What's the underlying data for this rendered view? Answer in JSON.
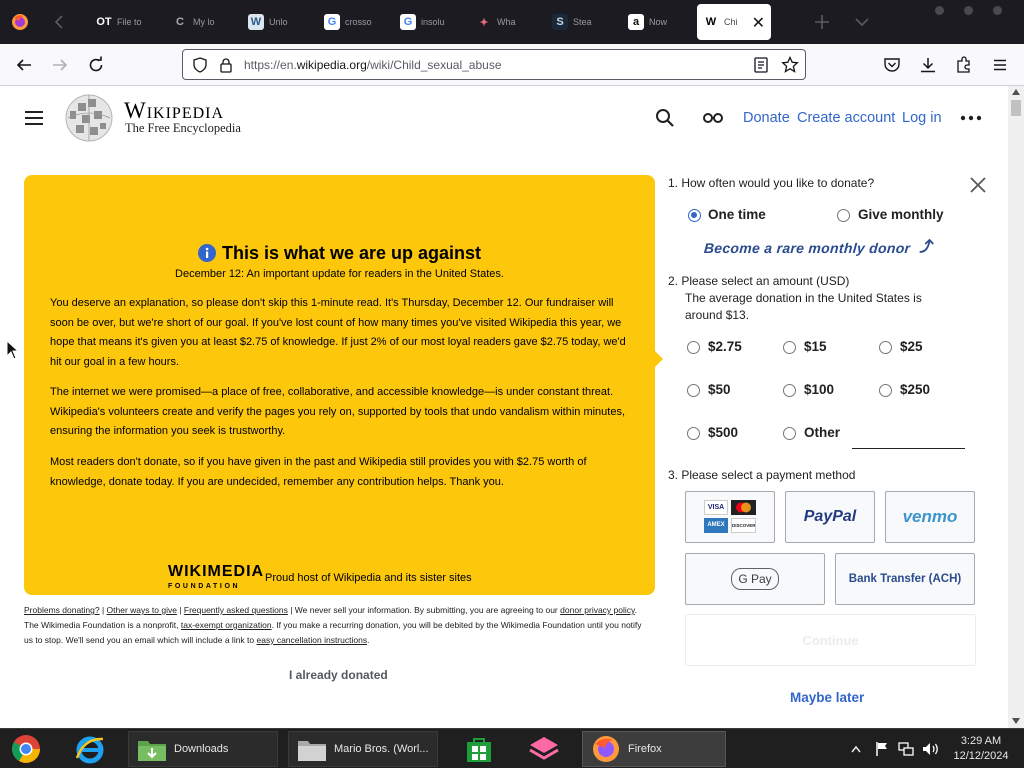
{
  "browser": {
    "tabs": [
      {
        "favicon": "OT",
        "title": "File to",
        "fav_bg": "#1c1b22",
        "fav_color": "#ffffff"
      },
      {
        "favicon": "C",
        "title": "My lo",
        "fav_bg": "#1c1b22",
        "fav_color": "#aaaaaa"
      },
      {
        "favicon": "W",
        "title": "Unlo",
        "fav_bg": "#dce6ee",
        "fav_color": "#2a5d8c"
      },
      {
        "favicon": "G",
        "title": "crosso",
        "fav_bg": "#ffffff",
        "fav_color": "#4285f4"
      },
      {
        "favicon": "G",
        "title": "insolu",
        "fav_bg": "#ffffff",
        "fav_color": "#4285f4"
      },
      {
        "favicon": "✦",
        "title": "Wha",
        "fav_bg": "#1c1b22",
        "fav_color": "#e26b7a"
      },
      {
        "favicon": "S",
        "title": "Stea",
        "fav_bg": "#1b2838",
        "fav_color": "#c7d5e0"
      },
      {
        "favicon": "a",
        "title": "Now",
        "fav_bg": "#ffffff",
        "fav_color": "#111111"
      },
      {
        "favicon": "W",
        "title": "Chi",
        "fav_bg": "#ffffff",
        "fav_color": "#000000"
      }
    ],
    "url_prefix": "https://en.",
    "url_domain": "wikipedia.org",
    "url_path": "/wiki/Child_sexual_abuse"
  },
  "wikipedia": {
    "title": "Wikipedia",
    "tagline": "The Free Encyclopedia",
    "donate": "Donate",
    "create_account": "Create account",
    "login": "Log in"
  },
  "banner": {
    "heading": "This is what we are up against",
    "subheading": "December 12: An important update for readers in the United States.",
    "paragraphs": [
      "You deserve an explanation, so please don't skip this 1-minute read. It's Thursday, December 12. Our fundraiser will soon be over, but we're short of our goal. If you've lost count of how many times you've visited Wikipedia this year, we hope that means it's given you at least $2.75 of knowledge. If just 2% of our most loyal readers gave $2.75 today, we'd hit our goal in a few hours.",
      "The internet we were promised—a place of free, collaborative, and accessible knowledge—is under constant threat. Wikipedia's volunteers create and verify the pages you rely on, supported by tools that undo vandalism within minutes, ensuring the information you seek is trustworthy.",
      "Most readers don't donate, so if you have given in the past and Wikipedia still provides you with $2.75 worth of knowledge, donate today. If you are undecided, remember any contribution helps. Thank you."
    ],
    "logo_main": "WIKIMEDIA",
    "logo_sub": "FOUNDATION",
    "host_line": "Proud host of Wikipedia and its sister sites",
    "accent": "#fdc70c"
  },
  "fineprint": {
    "problems": "Problems donating?",
    "other_ways": "Other ways to give",
    "faq": "Frequently asked questions",
    "text1": "We never sell your information. By submitting, you are agreeing to our",
    "donor_privacy": "donor privacy policy",
    "text2": ". The Wikimedia Foundation is a nonprofit,",
    "tax_exempt": "tax-exempt organization",
    "text3": ". If you make a recurring donation, you will be debited by the Wikimedia Foundation until you notify us to stop. We'll send you an email which will include a link to",
    "cancel": "easy cancellation instructions",
    "already_donated": "I already donated"
  },
  "form": {
    "q1": "1. How often would you like to donate?",
    "one_time": "One time",
    "monthly": "Give monthly",
    "monthly_note": "Become a rare monthly donor",
    "q2_line1": "2. Please select an amount (USD)",
    "q2_line2": "The average donation in the United States is",
    "q2_line3": "around $13.",
    "amounts": [
      "$2.75",
      "$15",
      "$25",
      "$50",
      "$100",
      "$250",
      "$500",
      "Other"
    ],
    "q3": "3. Please select a payment method",
    "paypal": "PayPal",
    "venmo": "venmo",
    "gpay": "G Pay",
    "bank": "Bank Transfer (ACH)",
    "visa": "VISA",
    "amex": "AMEX",
    "discover": "DISCOVER",
    "continue": "Continue",
    "maybe_later": "Maybe later"
  },
  "taskbar": {
    "downloads": "Downloads",
    "mario": "Mario Bros. (Worl...",
    "firefox": "Firefox",
    "time": "3:29 AM",
    "date": "12/12/2024"
  }
}
